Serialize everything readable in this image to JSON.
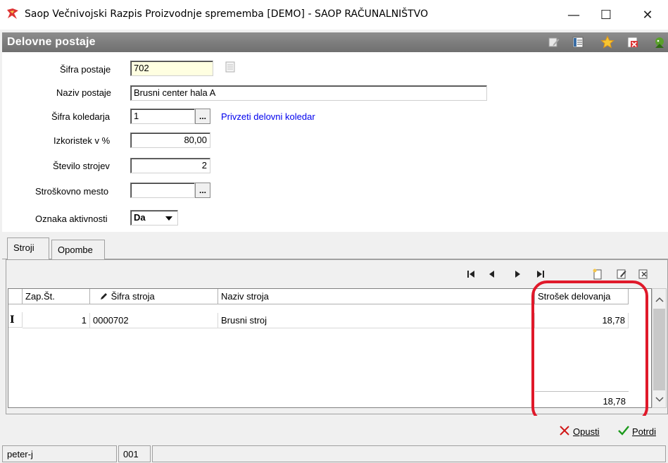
{
  "window": {
    "title": "Saop   Večnivojski Razpis Proizvodnje sprememba [DEMO] - SAOP RAČUNALNIŠTVO",
    "minimize": "—",
    "maximize": "☐",
    "close": "✕"
  },
  "header": {
    "title": "Delovne postaje"
  },
  "form": {
    "sifra_postaje": {
      "label": "Šifra postaje",
      "value": "702"
    },
    "naziv_postaje": {
      "label": "Naziv postaje",
      "value": "Brusni center hala A"
    },
    "sifra_koledarja": {
      "label": "Šifra koledarja",
      "value": "1",
      "link": "Privzeti delovni koledar"
    },
    "izkoristek": {
      "label": "Izkoristek v %",
      "value": "80,00"
    },
    "stevilo_strojev": {
      "label": "Število strojev",
      "value": "2"
    },
    "stroskovno_mesto": {
      "label": "Stroškovno mesto",
      "value": ""
    },
    "oznaka_aktivnosti": {
      "label": "Oznaka aktivnosti",
      "value": "Da"
    },
    "ellipsis": "..."
  },
  "tabs": [
    {
      "label": "Stroji",
      "active": true
    },
    {
      "label": "Opombe",
      "active": false
    }
  ],
  "grid": {
    "columns": [
      "Zap.Št.",
      "Šifra stroja",
      "Naziv stroja",
      "Strošek delovanja"
    ],
    "rows": [
      {
        "zap": "1",
        "sifra": "0000702",
        "naziv": "Brusni stroj",
        "strosek": "18,78"
      }
    ],
    "total": "18,78",
    "row_marker": "I"
  },
  "footer": {
    "cancel": "Opusti",
    "confirm": "Potrdi"
  },
  "status": {
    "user": "peter-j",
    "code": "001"
  },
  "colors": {
    "header_band": "#7a7a7a",
    "highlight": "#e0192a",
    "link": "#0000ee",
    "key_field": "#ffffe1"
  }
}
